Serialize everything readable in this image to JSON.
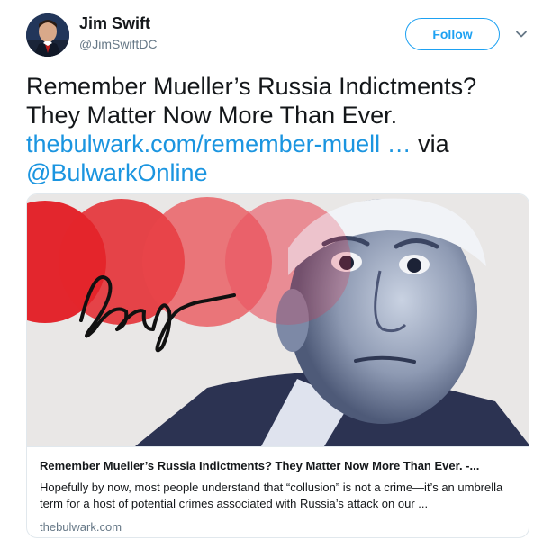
{
  "author": {
    "name": "Jim Swift",
    "handle": "@JimSwiftDC"
  },
  "follow_label": "Follow",
  "tweet": {
    "line1": "Remember Mueller’s Russia Indictments?",
    "line2": "They Matter Now More Than Ever.",
    "link_text": "thebulwark.com/remember-muell",
    "ellipsis": " …",
    "via_text": " via",
    "mention": "@BulwarkOnline"
  },
  "card": {
    "title": "Remember Mueller’s Russia Indictments? They Matter Now More Than Ever. -...",
    "description": "Hopefully by now, most people understand that “collusion” is not a crime—it’s an umbrella term for a host of potential crimes associated with Russia’s attack on our ...",
    "domain": "thebulwark.com"
  },
  "icons": {
    "caret": "chevron-down-icon"
  },
  "colors": {
    "accent": "#1da1f2",
    "link": "#1b95e0",
    "muted": "#657786"
  }
}
